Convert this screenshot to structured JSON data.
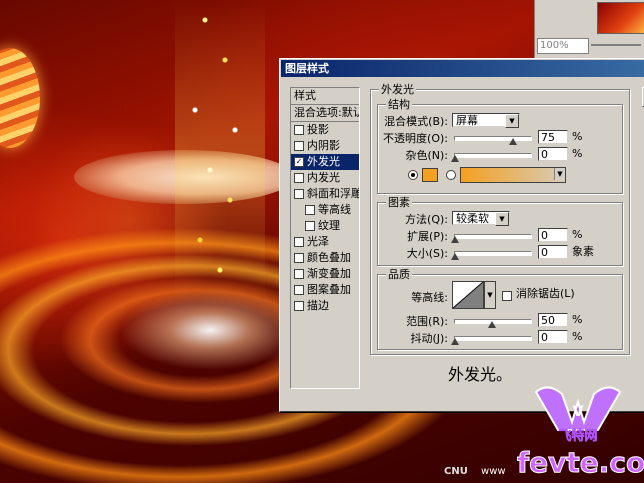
{
  "dialog": {
    "title": "图层样式",
    "sidebar": {
      "header": "样式",
      "blend": "混合选项:默认",
      "items": [
        {
          "label": "投影",
          "checked": false,
          "indent": false
        },
        {
          "label": "内阴影",
          "checked": false,
          "indent": false
        },
        {
          "label": "外发光",
          "checked": true,
          "indent": false,
          "selected": true
        },
        {
          "label": "内发光",
          "checked": false,
          "indent": false
        },
        {
          "label": "斜面和浮雕",
          "checked": false,
          "indent": false
        },
        {
          "label": "等高线",
          "checked": false,
          "indent": true
        },
        {
          "label": "纹理",
          "checked": false,
          "indent": true
        },
        {
          "label": "光泽",
          "checked": false,
          "indent": false
        },
        {
          "label": "颜色叠加",
          "checked": false,
          "indent": false
        },
        {
          "label": "渐变叠加",
          "checked": false,
          "indent": false
        },
        {
          "label": "图案叠加",
          "checked": false,
          "indent": false
        },
        {
          "label": "描边",
          "checked": false,
          "indent": false
        }
      ]
    },
    "panel": {
      "title": "外发光",
      "structure": {
        "title": "结构",
        "blend_mode_label": "混合模式(B):",
        "blend_mode_value": "屏幕",
        "opacity_label": "不透明度(O):",
        "opacity_value": "75",
        "opacity_unit": "%",
        "noise_label": "杂色(N):",
        "noise_value": "0",
        "noise_unit": "%",
        "color_swatch": "#f4a020"
      },
      "elements": {
        "title": "图素",
        "method_label": "方法(Q):",
        "method_value": "较柔软",
        "spread_label": "扩展(P):",
        "spread_value": "0",
        "spread_unit": "%",
        "size_label": "大小(S):",
        "size_value": "0",
        "size_unit": "象素"
      },
      "quality": {
        "title": "品质",
        "contour_label": "等高线:",
        "antialias_label": "消除锯齿(L)",
        "range_label": "范围(R):",
        "range_value": "50",
        "range_unit": "%",
        "jitter_label": "抖动(J):",
        "jitter_value": "0",
        "jitter_unit": "%"
      },
      "caption": "外发光。"
    }
  },
  "navigator": {
    "zoom": "100%"
  },
  "watermark": {
    "logo_text": "飞特网",
    "site": "fevte.com",
    "cnu": "CNU",
    "www": "www"
  }
}
